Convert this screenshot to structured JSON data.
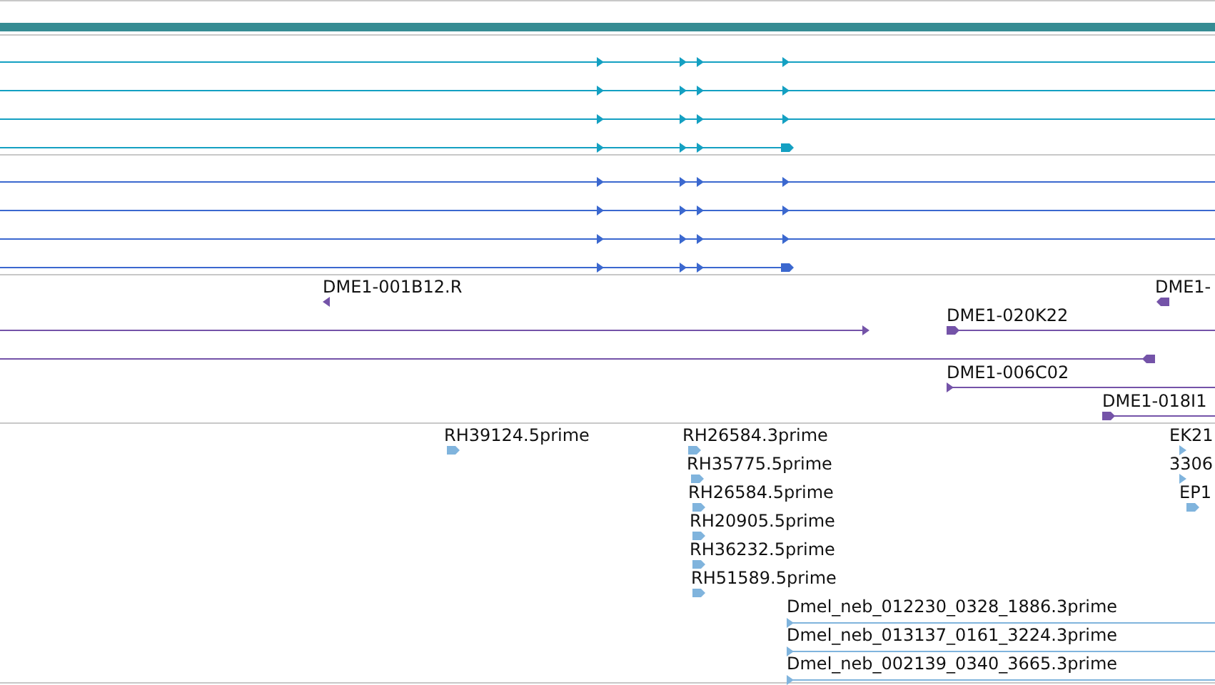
{
  "tracks": [
    {
      "kind": "bar",
      "color": "#368c93"
    },
    {
      "kind": "transcripts",
      "color": "#14a0c2",
      "features": [
        {
          "reverse": false,
          "complete": false
        },
        {
          "reverse": false,
          "complete": false
        },
        {
          "reverse": false,
          "complete": false
        },
        {
          "reverse": false,
          "complete": true
        }
      ]
    },
    {
      "kind": "transcripts",
      "color": "#3b68cf",
      "features": [
        {
          "reverse": false,
          "complete": false
        },
        {
          "reverse": false,
          "complete": false
        },
        {
          "reverse": false,
          "complete": false
        },
        {
          "reverse": false,
          "complete": true
        }
      ]
    },
    {
      "kind": "clones",
      "color": "#7453a8",
      "features": [
        {
          "label": "DME1-001B12.R",
          "reverse": true
        },
        {
          "label": "DME1-",
          "reverse": true
        },
        {
          "reverse": false
        },
        {
          "label": "DME1-020K22",
          "reverse": false
        },
        {
          "reverse": true
        },
        {
          "label": "DME1-006C02",
          "reverse": false
        },
        {
          "label": "DME1-018I1",
          "reverse": false
        }
      ]
    },
    {
      "kind": "clones",
      "color": "#80b4dd",
      "features": [
        {
          "label": "RH39124.5prime",
          "reverse": false
        },
        {
          "label": "RH26584.3prime",
          "reverse": false
        },
        {
          "label": "RH35775.5prime",
          "reverse": false
        },
        {
          "label": "RH26584.5prime",
          "reverse": false
        },
        {
          "label": "RH20905.5prime",
          "reverse": false
        },
        {
          "label": "RH36232.5prime",
          "reverse": false
        },
        {
          "label": "RH51589.5prime",
          "reverse": false
        },
        {
          "label": "EK21",
          "reverse": false
        },
        {
          "label": "3306",
          "reverse": false
        },
        {
          "label": "EP1",
          "reverse": false
        },
        {
          "label": "Dmel_neb_012230_0328_1886.3prime",
          "reverse": false
        },
        {
          "label": "Dmel_neb_013137_0161_3224.3prime",
          "reverse": false
        },
        {
          "label": "Dmel_neb_002139_0340_3665.3prime",
          "reverse": false
        }
      ]
    }
  ]
}
